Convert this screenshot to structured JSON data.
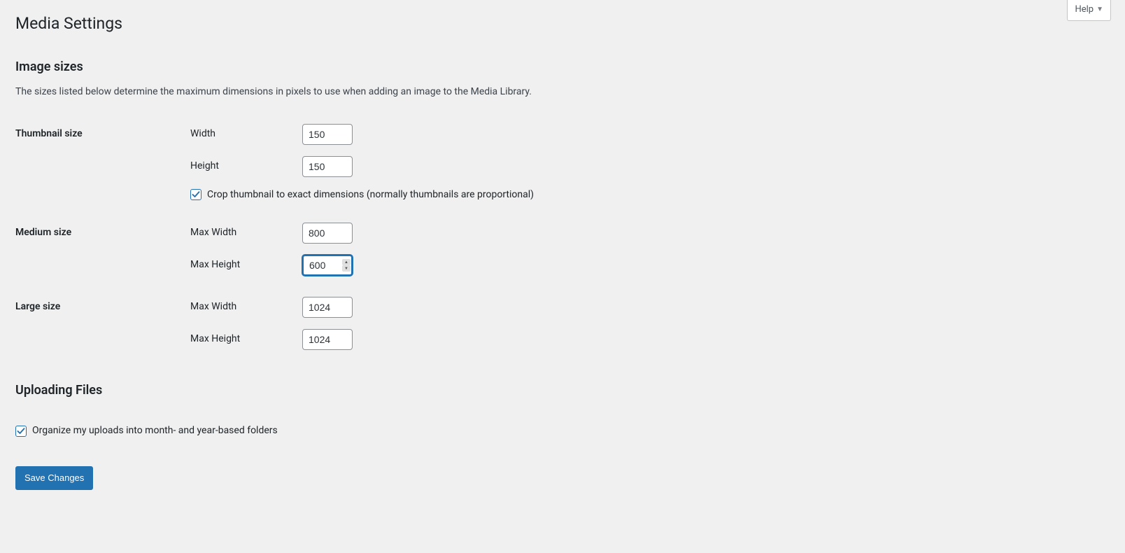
{
  "help": {
    "label": "Help"
  },
  "page": {
    "title": "Media Settings"
  },
  "image_sizes": {
    "heading": "Image sizes",
    "description": "The sizes listed below determine the maximum dimensions in pixels to use when adding an image to the Media Library.",
    "thumbnail": {
      "label": "Thumbnail size",
      "width_label": "Width",
      "width_value": "150",
      "height_label": "Height",
      "height_value": "150",
      "crop_label": "Crop thumbnail to exact dimensions (normally thumbnails are proportional)",
      "crop_checked": true
    },
    "medium": {
      "label": "Medium size",
      "max_width_label": "Max Width",
      "max_width_value": "800",
      "max_height_label": "Max Height",
      "max_height_value": "600"
    },
    "large": {
      "label": "Large size",
      "max_width_label": "Max Width",
      "max_width_value": "1024",
      "max_height_label": "Max Height",
      "max_height_value": "1024"
    }
  },
  "uploading": {
    "heading": "Uploading Files",
    "organize_label": "Organize my uploads into month- and year-based folders",
    "organize_checked": true
  },
  "submit": {
    "label": "Save Changes"
  }
}
